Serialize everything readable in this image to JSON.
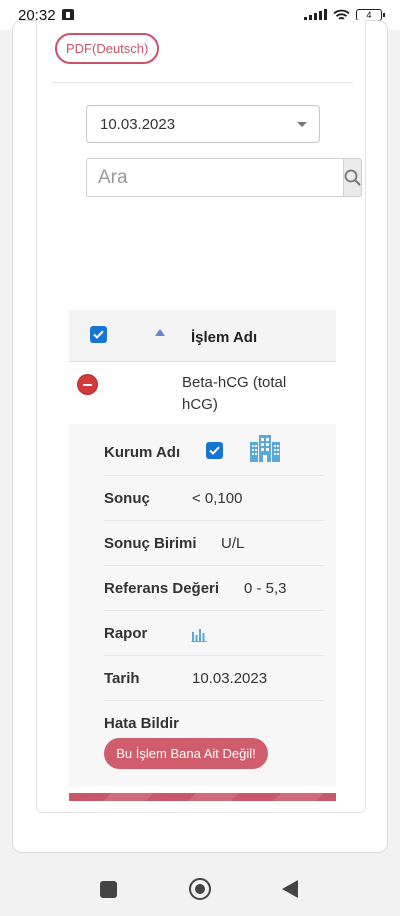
{
  "status_bar": {
    "time": "20:32",
    "battery": "4",
    "icons": [
      "notification-icon",
      "signal-icon",
      "wifi-icon",
      "battery-icon"
    ]
  },
  "toolbar": {
    "pdf_label": "PDF(Deutsch)"
  },
  "filters": {
    "date_selected": "10.03.2023",
    "search_placeholder": "Ara",
    "search_value": ""
  },
  "table": {
    "header": {
      "column_title": "İşlem Adı",
      "select_all_checked": true
    },
    "row": {
      "name": "Beta-hCG (total hCG)",
      "expanded": true,
      "details": {
        "institution_label": "Kurum Adı",
        "institution_checked": true,
        "result_label": "Sonuç",
        "result_value": "< 0,100",
        "unit_label": "Sonuç Birimi",
        "unit_value": "U/L",
        "reference_label": "Referans Değeri",
        "reference_value": "0 - 5,3",
        "report_label": "Rapor",
        "date_label": "Tarih",
        "date_value": "10.03.2023",
        "error_label": "Hata Bildir",
        "error_button": "Bu İşlem Bana Ait Değil!"
      }
    }
  },
  "colors": {
    "accent_pink": "#c9536a",
    "checkbox_blue": "#1574d4",
    "minus_red": "#d23b3b",
    "icon_blue": "#5aa9d9"
  }
}
